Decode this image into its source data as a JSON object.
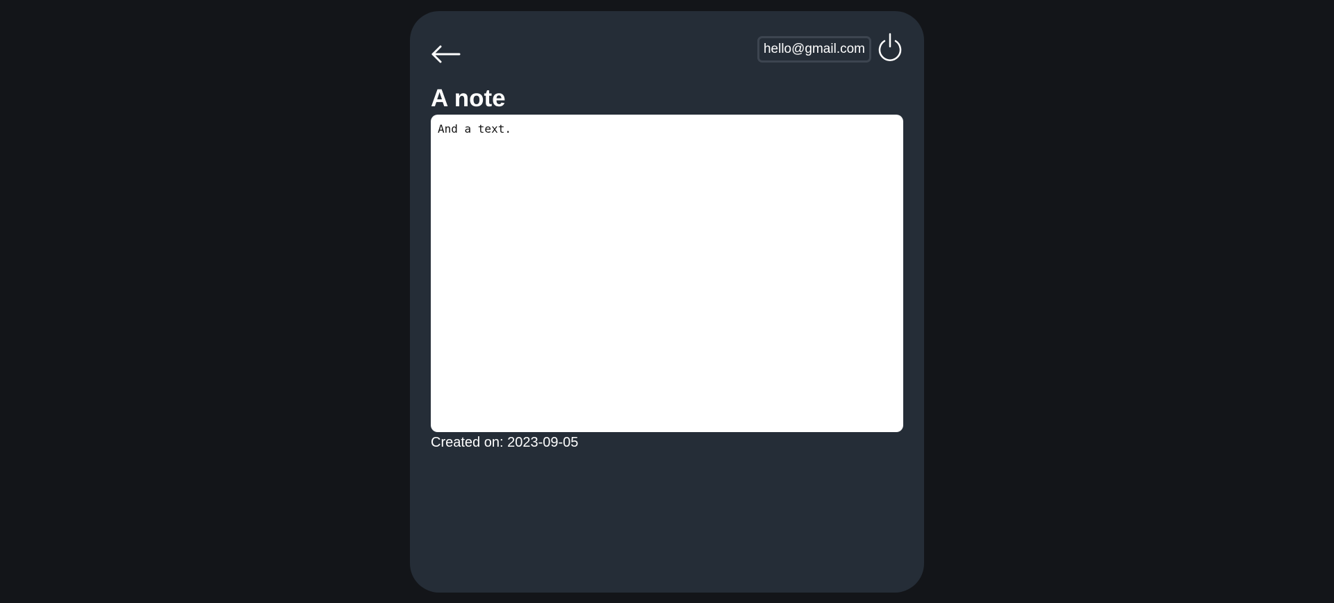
{
  "header": {
    "back_icon": "arrow-left-icon",
    "user_email": "hello@gmail.com",
    "logout_icon": "power-icon"
  },
  "note": {
    "title": "A note",
    "text": "And a text.",
    "created_label": "Created on:",
    "created_date": "2023-09-05"
  },
  "colors": {
    "page_background": "#131519",
    "card_background": "#252d37",
    "badge_border": "#3d4550",
    "text": "#ffffff",
    "editor_background": "#ffffff"
  }
}
